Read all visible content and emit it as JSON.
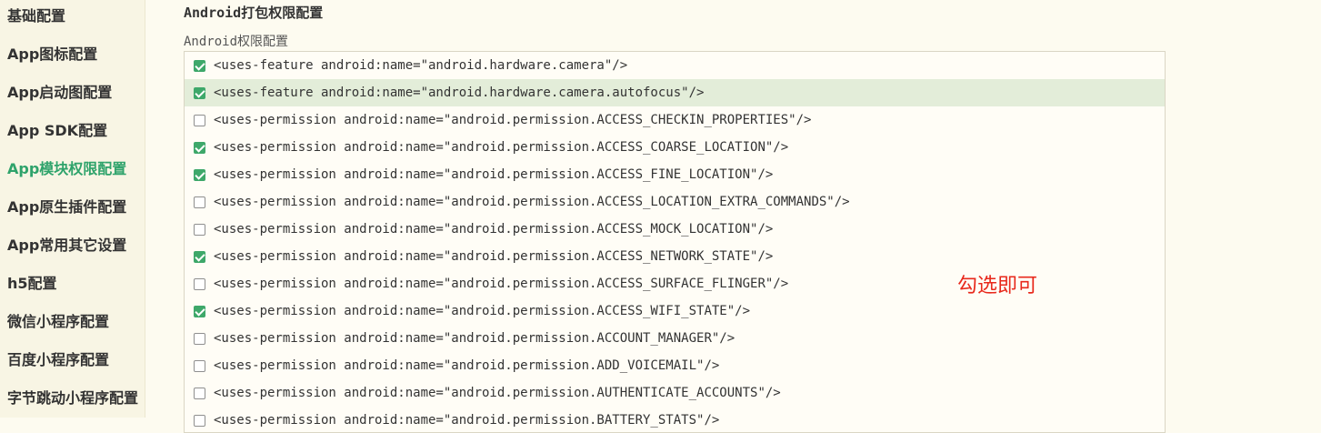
{
  "sidebar": {
    "active_color": "#2fa36b",
    "items": [
      {
        "label": "基础配置",
        "active": false
      },
      {
        "label": "App图标配置",
        "active": false
      },
      {
        "label": "App启动图配置",
        "active": false
      },
      {
        "label": "App SDK配置",
        "active": false
      },
      {
        "label": "App模块权限配置",
        "active": true
      },
      {
        "label": "App原生插件配置",
        "active": false
      },
      {
        "label": "App常用其它设置",
        "active": false
      },
      {
        "label": "h5配置",
        "active": false
      },
      {
        "label": "微信小程序配置",
        "active": false
      },
      {
        "label": "百度小程序配置",
        "active": false
      },
      {
        "label": "字节跳动小程序配置",
        "active": false
      }
    ]
  },
  "main": {
    "section_title": "Android打包权限配置",
    "sub_title": "Android权限配置",
    "checkbox_color": "#3ea86a",
    "permissions": [
      {
        "text": "<uses-feature android:name=\"android.hardware.camera\"/>",
        "checked": true
      },
      {
        "text": "<uses-feature android:name=\"android.hardware.camera.autofocus\"/>",
        "checked": true,
        "highlighted": true
      },
      {
        "text": "<uses-permission android:name=\"android.permission.ACCESS_CHECKIN_PROPERTIES\"/>",
        "checked": false
      },
      {
        "text": "<uses-permission android:name=\"android.permission.ACCESS_COARSE_LOCATION\"/>",
        "checked": true
      },
      {
        "text": "<uses-permission android:name=\"android.permission.ACCESS_FINE_LOCATION\"/>",
        "checked": true
      },
      {
        "text": "<uses-permission android:name=\"android.permission.ACCESS_LOCATION_EXTRA_COMMANDS\"/>",
        "checked": false
      },
      {
        "text": "<uses-permission android:name=\"android.permission.ACCESS_MOCK_LOCATION\"/>",
        "checked": false
      },
      {
        "text": "<uses-permission android:name=\"android.permission.ACCESS_NETWORK_STATE\"/>",
        "checked": true
      },
      {
        "text": "<uses-permission android:name=\"android.permission.ACCESS_SURFACE_FLINGER\"/>",
        "checked": false
      },
      {
        "text": "<uses-permission android:name=\"android.permission.ACCESS_WIFI_STATE\"/>",
        "checked": true
      },
      {
        "text": "<uses-permission android:name=\"android.permission.ACCOUNT_MANAGER\"/>",
        "checked": false
      },
      {
        "text": "<uses-permission android:name=\"android.permission.ADD_VOICEMAIL\"/>",
        "checked": false
      },
      {
        "text": "<uses-permission android:name=\"android.permission.AUTHENTICATE_ACCOUNTS\"/>",
        "checked": false
      },
      {
        "text": "<uses-permission android:name=\"android.permission.BATTERY_STATS\"/>",
        "checked": false
      }
    ]
  },
  "annotation": {
    "text": "勾选即可",
    "color": "#e8291c"
  }
}
